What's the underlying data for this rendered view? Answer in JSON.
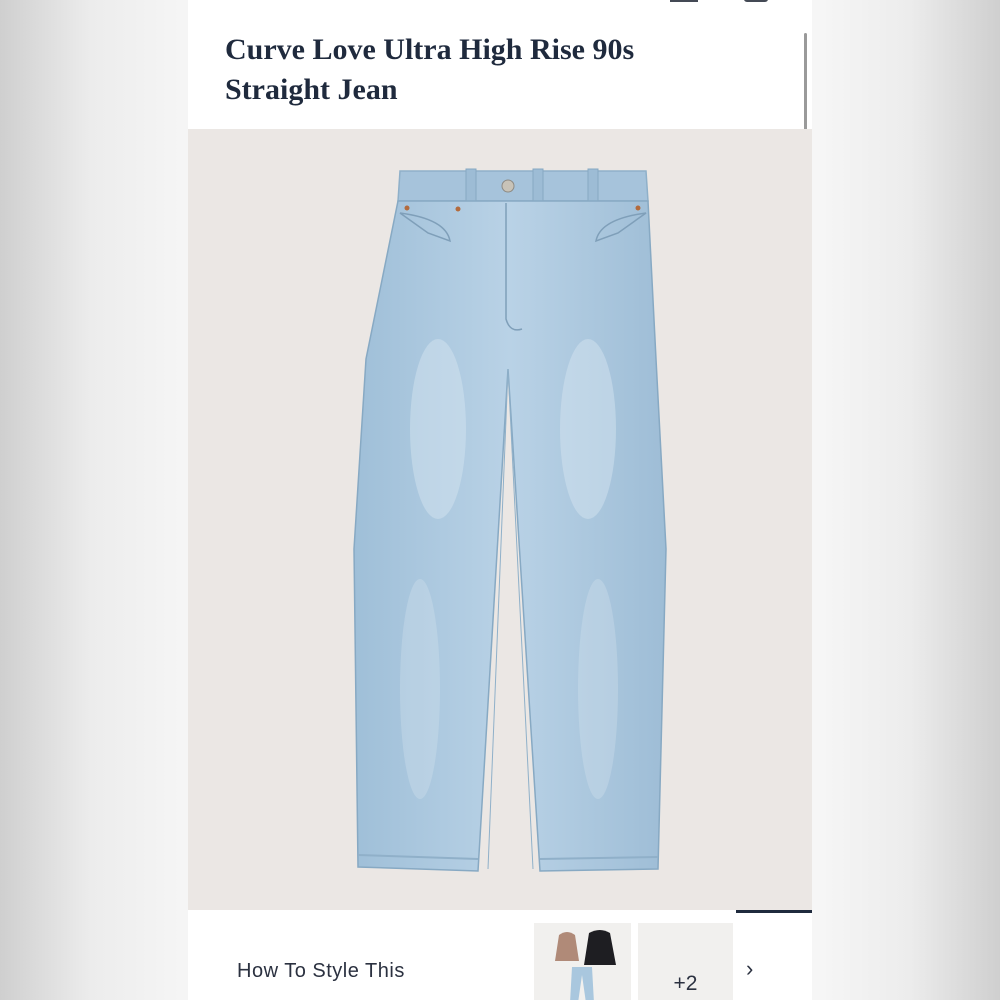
{
  "product": {
    "title_line1": "Curve Love Ultra High Rise 90s",
    "title_line2": "Straight Jean",
    "image_icon": "light-wash-straight-jeans-photo",
    "background_color": "#ebe7e4",
    "denim_color": "#a9c7de"
  },
  "style_section": {
    "label": "How To Style This",
    "thumbnail_icon": "outfit-thumbnail",
    "more_count": "+2",
    "next_icon": "chevron-right-icon",
    "next_glyph": "›"
  },
  "header_icons": [
    "menu-icon",
    "bag-icon"
  ]
}
